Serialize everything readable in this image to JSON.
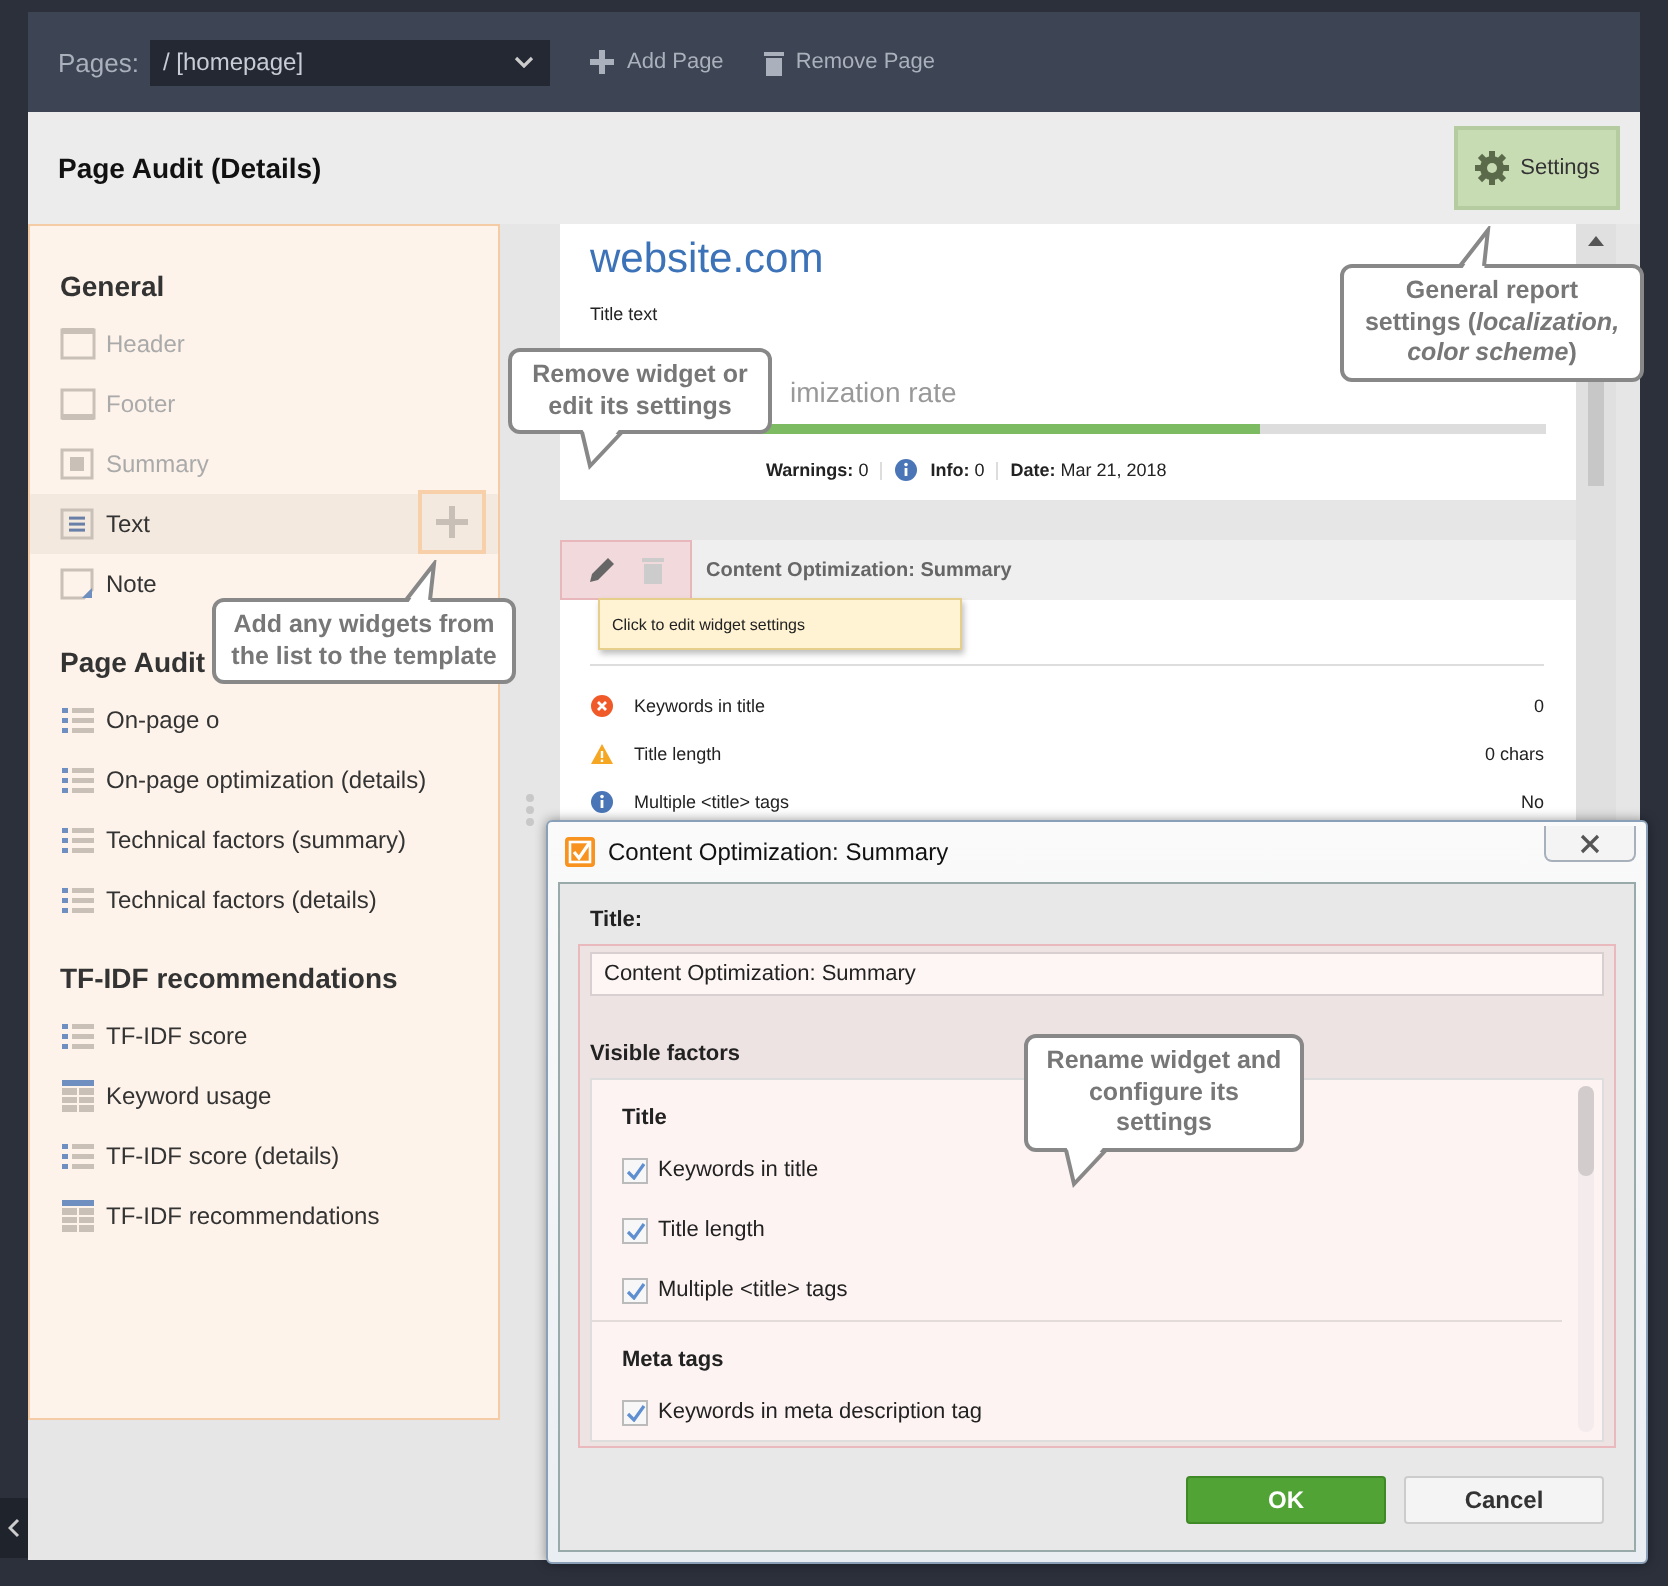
{
  "top_bar": {
    "pages_label": "Pages:",
    "page_select": "/ [homepage]",
    "actions": [
      {
        "kind": "add",
        "label": "Add Page"
      },
      {
        "kind": "remove",
        "label": "Remove Page"
      }
    ]
  },
  "header": {
    "title": "Page Audit (Details)",
    "settings_button": "Settings"
  },
  "sidebar": {
    "sections": [
      {
        "title": "General",
        "items": [
          {
            "kind": "header",
            "label": "Header",
            "disabled": true,
            "selected": false
          },
          {
            "kind": "footer",
            "label": "Footer",
            "disabled": true,
            "selected": false
          },
          {
            "kind": "summary",
            "label": "Summary",
            "disabled": true,
            "selected": false
          },
          {
            "kind": "text",
            "label": "Text",
            "disabled": false,
            "selected": true
          },
          {
            "kind": "note",
            "label": "Note",
            "disabled": false,
            "selected": false
          }
        ]
      },
      {
        "title": "Page Audit",
        "items": [
          {
            "kind": "list",
            "label": "On-page o",
            "disabled": false,
            "selected": false
          },
          {
            "kind": "list",
            "label": "On-page optimization (details)",
            "disabled": false,
            "selected": false
          },
          {
            "kind": "list",
            "label": "Technical factors (summary)",
            "disabled": false,
            "selected": false
          },
          {
            "kind": "list",
            "label": "Technical factors (details)",
            "disabled": false,
            "selected": false
          }
        ]
      },
      {
        "title": "TF-IDF recommendations",
        "items": [
          {
            "kind": "list",
            "label": "TF-IDF score",
            "disabled": false,
            "selected": false
          },
          {
            "kind": "table",
            "label": "Keyword usage",
            "disabled": false,
            "selected": false
          },
          {
            "kind": "list",
            "label": "TF-IDF score (details)",
            "disabled": false,
            "selected": false
          },
          {
            "kind": "table",
            "label": "TF-IDF recommendations",
            "disabled": false,
            "selected": false
          }
        ]
      }
    ]
  },
  "report": {
    "site": "website.com",
    "title_text": "Title text",
    "rate_label": "imization rate",
    "rate_bar": {
      "level": 0.7
    },
    "stats": [
      {
        "kind": "plain",
        "label": "Warnings:",
        "value": "0"
      },
      {
        "kind": "info",
        "label": "Info:",
        "value": "0"
      },
      {
        "kind": "plain",
        "label": "Date:",
        "value": "Mar 21, 2018"
      }
    ]
  },
  "widget": {
    "title": "Content Optimization: Summary",
    "tooltip": "Click to edit widget settings",
    "rows": [
      {
        "kind": "error",
        "label": "Keywords in title",
        "value": "0"
      },
      {
        "kind": "warning",
        "label": "Title length",
        "value": "0 chars"
      },
      {
        "kind": "info",
        "label": "Multiple <title> tags",
        "value": "No"
      }
    ]
  },
  "dialog": {
    "title": "Content Optimization: Summary",
    "title_label": "Title:",
    "title_value": "Content Optimization: Summary",
    "factors_label": "Visible factors",
    "groups": [
      {
        "title": "Title",
        "items": [
          {
            "label": "Keywords in title",
            "checked": true
          },
          {
            "label": "Title length",
            "checked": true
          },
          {
            "label": "Multiple <title> tags",
            "checked": true
          }
        ]
      },
      {
        "title": "Meta tags",
        "items": [
          {
            "label": "Keywords in meta description tag",
            "checked": true
          }
        ]
      }
    ],
    "buttons": [
      {
        "kind": "primary",
        "label": "OK"
      },
      {
        "kind": "secondary",
        "label": "Cancel"
      }
    ]
  },
  "callouts": [
    {
      "kind": "widget-actions",
      "text": "Remove widget or edit its settings"
    },
    {
      "kind": "settings",
      "text": "General report settings (*localization,* *color scheme*)"
    },
    {
      "kind": "sidebar-add",
      "text": "Add any widgets from the list to the template"
    },
    {
      "kind": "dialog",
      "text": "Rename widget and configure its settings"
    }
  ]
}
